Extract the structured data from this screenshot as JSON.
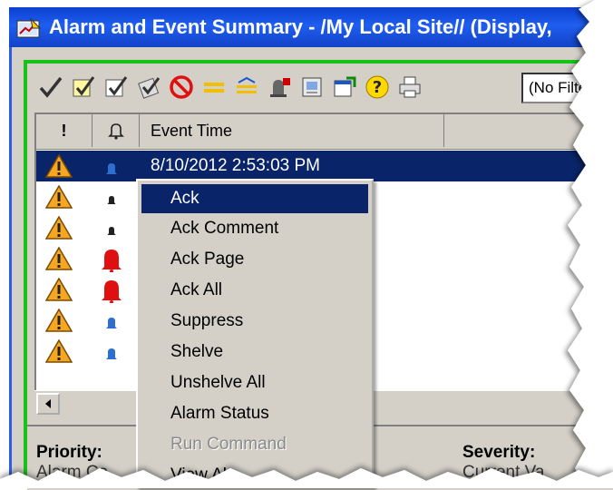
{
  "window": {
    "title": "Alarm and Event Summary - /My Local Site// (Display,"
  },
  "toolbar": {
    "buttons": [
      {
        "icon": "checkmark-icon"
      },
      {
        "icon": "ack-note-icon"
      },
      {
        "icon": "ack-page-icon"
      },
      {
        "icon": "ack-all-icon"
      },
      {
        "icon": "suppress-icon"
      },
      {
        "icon": "shelve-icon"
      },
      {
        "icon": "unshelve-icon"
      },
      {
        "icon": "alarm-status-icon"
      },
      {
        "icon": "display-icon"
      },
      {
        "icon": "properties-icon"
      },
      {
        "icon": "help-icon"
      },
      {
        "icon": "print-icon"
      }
    ],
    "filter_value": "(No Filter)"
  },
  "grid": {
    "columns": [
      "!",
      "bell",
      "Event Time"
    ],
    "rows": [
      {
        "priority_icon": "warning-icon",
        "bell": "small-blue-bell",
        "time": "8/10/2012 2:53:03 PM",
        "selected": true
      },
      {
        "priority_icon": "warning-icon",
        "bell": "small-black-bell",
        "time": "",
        "selected": false
      },
      {
        "priority_icon": "warning-icon",
        "bell": "small-black-bell",
        "time": "",
        "selected": false
      },
      {
        "priority_icon": "warning-icon",
        "bell": "large-red-bell",
        "time": "",
        "selected": false
      },
      {
        "priority_icon": "warning-icon",
        "bell": "large-red-bell",
        "time": "",
        "selected": false
      },
      {
        "priority_icon": "warning-icon",
        "bell": "small-blue-bell",
        "time": "",
        "selected": false
      },
      {
        "priority_icon": "warning-icon",
        "bell": "small-blue-bell",
        "time": "",
        "selected": false
      }
    ]
  },
  "context_menu": {
    "items": [
      {
        "label": "Ack",
        "highlighted": true,
        "disabled": false
      },
      {
        "label": "Ack Comment",
        "highlighted": false,
        "disabled": false
      },
      {
        "label": "Ack Page",
        "highlighted": false,
        "disabled": false
      },
      {
        "label": "Ack All",
        "highlighted": false,
        "disabled": false
      },
      {
        "label": "Suppress",
        "highlighted": false,
        "disabled": false
      },
      {
        "label": "Shelve",
        "highlighted": false,
        "disabled": false
      },
      {
        "label": "Unshelve All",
        "highlighted": false,
        "disabled": false
      },
      {
        "label": "Alarm Status",
        "highlighted": false,
        "disabled": false
      },
      {
        "label": "Run Command",
        "highlighted": false,
        "disabled": true
      },
      {
        "label": "View Al",
        "highlighted": false,
        "disabled": false
      }
    ]
  },
  "details": {
    "priority_label": "Priority:",
    "severity_label": "Severity:",
    "partial_left": "Alarm Ca",
    "partial_right": "Current Va"
  },
  "colors": {
    "title_blue": "#1f5ef0",
    "selection": "#0a246a",
    "frame_green": "#17c317",
    "chrome": "#d4d0c8"
  }
}
